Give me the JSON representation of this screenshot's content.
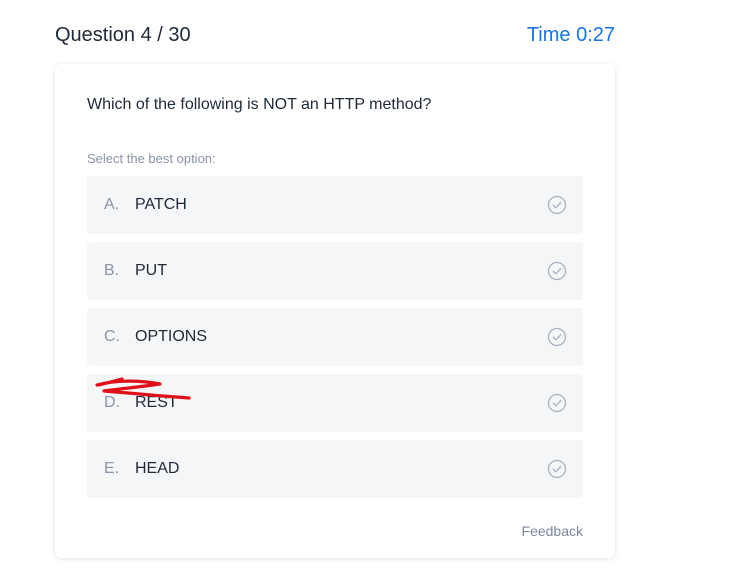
{
  "header": {
    "question_counter": "Question 4 / 30",
    "timer": "Time 0:27"
  },
  "question": {
    "text": "Which of the following is NOT an HTTP method?",
    "hint": "Select the best option:"
  },
  "options": [
    {
      "letter": "A.",
      "text": "PATCH"
    },
    {
      "letter": "B.",
      "text": "PUT"
    },
    {
      "letter": "C.",
      "text": "OPTIONS"
    },
    {
      "letter": "D.",
      "text": "REST"
    },
    {
      "letter": "E.",
      "text": "HEAD"
    }
  ],
  "feedback_label": "Feedback",
  "icons": {
    "option_check": "check-circle-icon"
  },
  "annotation": {
    "type": "red hand-drawn arrow pointing at option D",
    "color": "#e0101a"
  },
  "colors": {
    "accent": "#1a73e8",
    "option_bg": "#f5f6f8",
    "muted_text": "#8a94a6"
  }
}
